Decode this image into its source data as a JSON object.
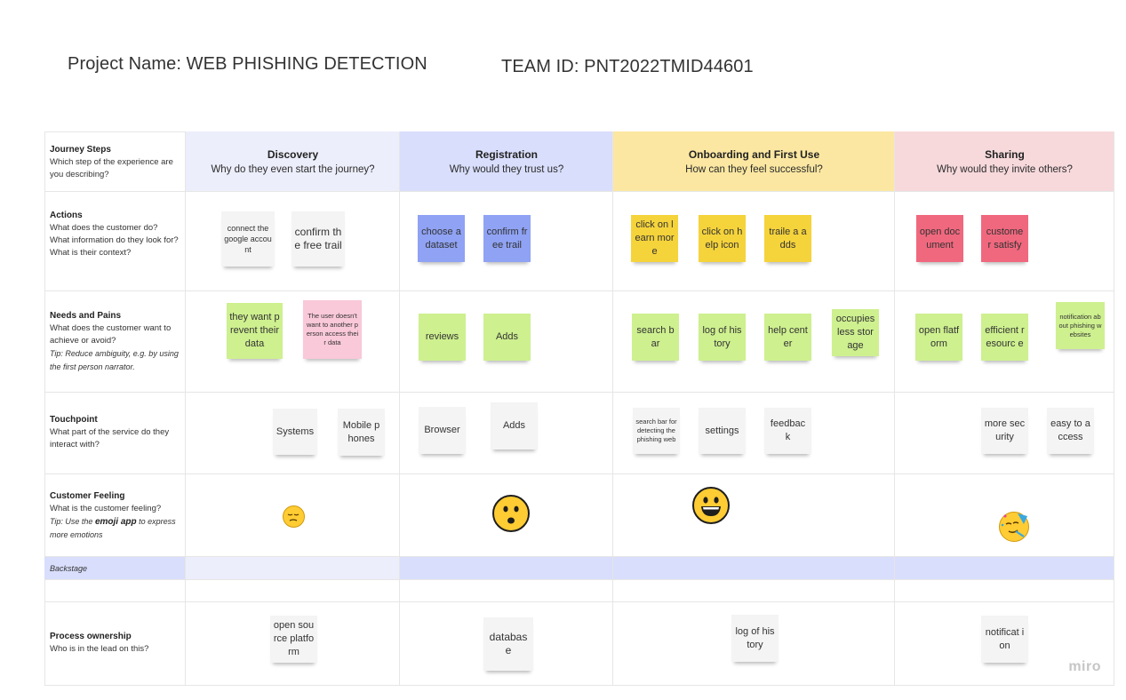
{
  "header": {
    "project_name": "Project Name: WEB PHISHING DETECTION",
    "team_id": "TEAM ID: PNT2022TMID44601"
  },
  "rows": {
    "journey": {
      "title": "Journey Steps",
      "desc": "Which step of the experience are you describing?"
    },
    "actions": {
      "title": "Actions",
      "desc": "What does the customer do? What information do they look for? What is their context?"
    },
    "needs": {
      "title": "Needs and Pains",
      "desc": "What does the customer want to achieve or avoid?",
      "tip": "Tip: Reduce ambiguity, e.g. by using the first person narrator."
    },
    "touchpoint": {
      "title": "Touchpoint",
      "desc": "What part of the service do they interact with?"
    },
    "feeling": {
      "title": "Customer Feeling",
      "desc": "What is the customer feeling?",
      "tip_pre": "Tip: Use the ",
      "tip_bold": "emoji app",
      "tip_post": " to express more emotions"
    },
    "backstage": {
      "title": "Backstage"
    },
    "ownership": {
      "title": "Process ownership",
      "desc": "Who is in the lead on this?"
    }
  },
  "stages": [
    {
      "title": "Discovery",
      "sub": "Why do they even start the journey?",
      "color": "#eceefb"
    },
    {
      "title": "Registration",
      "sub": "Why would they trust us?",
      "color": "#d9defc"
    },
    {
      "title": "Onboarding and First Use",
      "sub": "How can they feel successful?",
      "color": "#fbe7a1"
    },
    {
      "title": "Sharing",
      "sub": "Why would they invite others?",
      "color": "#f7d9dc"
    }
  ],
  "notes": {
    "actions": [
      "connect the google account",
      "confirm the free trail",
      "choose a dataset",
      "confirm free trail",
      "click on learn more",
      "click on help icon",
      "traile a adds",
      "open document",
      "custome r satisfy"
    ],
    "needs": [
      "they want prevent their data",
      "The user doesn't want to another person access their data",
      "reviews",
      "Adds",
      "search bar",
      "log of history",
      "help center",
      "occupies less storage",
      "open flatform",
      "efficient resourc e",
      "notification about phishing websites"
    ],
    "touchpoint": [
      "Systems",
      "Mobile phones",
      "Browser",
      "Adds",
      "search bar for detecting the phishing web",
      "settings",
      "feedbac k",
      "more security",
      "easy to access"
    ],
    "ownership": [
      "open source platform",
      "databas e",
      "log of history",
      "notificat ion"
    ]
  },
  "emojis": {
    "discovery": "pensive-face-icon",
    "registration": "frowning-face-icon",
    "onboarding": "grinning-face-icon",
    "sharing": "party-face-icon"
  },
  "brand": "miro"
}
